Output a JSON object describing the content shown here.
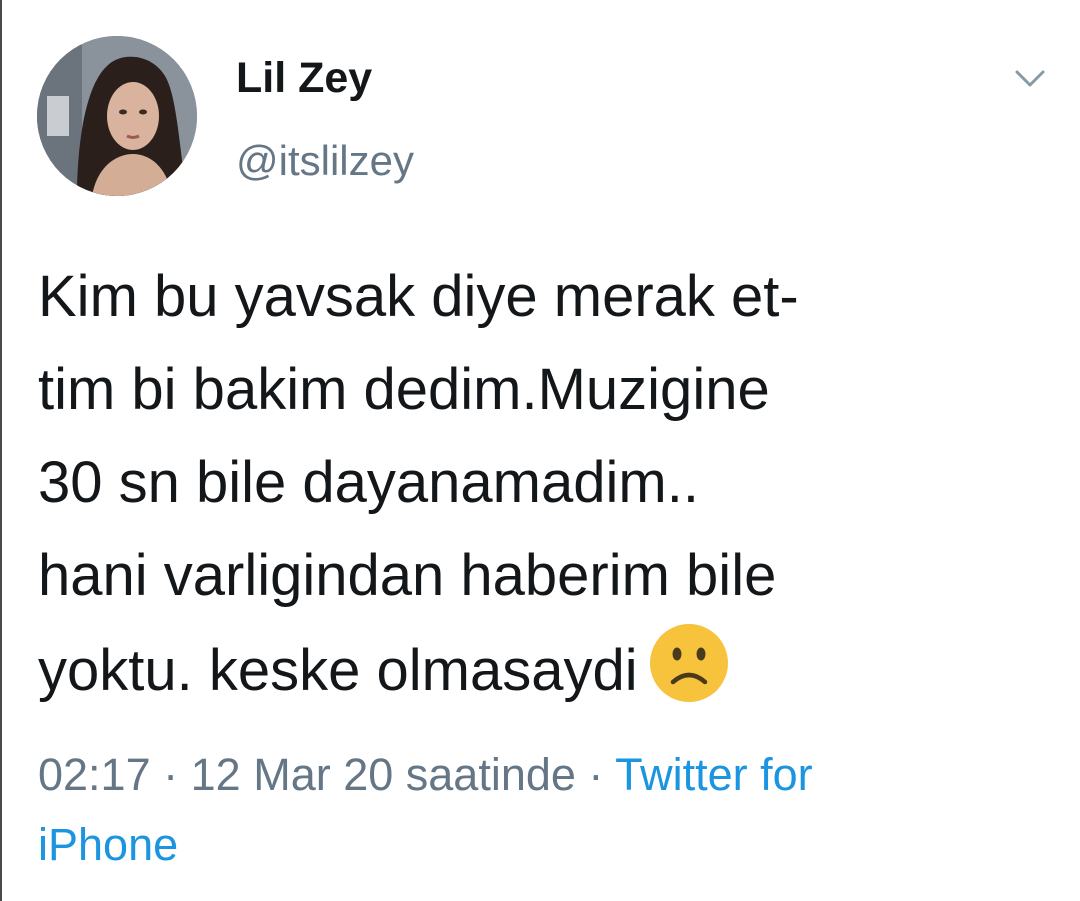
{
  "tweet": {
    "author": {
      "display_name": "Lil Zey",
      "handle": "@itslilzey",
      "avatar_icon": "profile-photo"
    },
    "menu_icon": "chevron-down-icon",
    "text_lines": [
      "Kim bu yavsak diye merak et-",
      "tim bi bakim dedim.Muzigine",
      "30 sn bile dayanamadim..",
      "hani varligindan haberim bile",
      "yoktu. keske olmasaydi"
    ],
    "emoji": "slightly-frowning-face-emoji",
    "time": "02:17",
    "separator": "·",
    "date": "12 Mar 20 saatinde",
    "source_line1": "Twitter for",
    "source_line2": "iPhone"
  },
  "colors": {
    "text": "#14171a",
    "secondary": "#657786",
    "link": "#1b95e0",
    "emoji_face": "#f7c23c"
  }
}
